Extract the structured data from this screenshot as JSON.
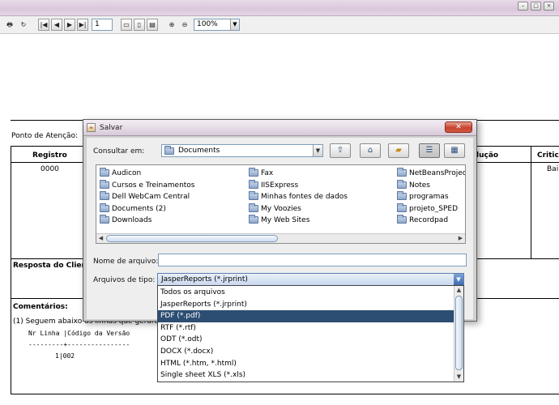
{
  "toolbar": {
    "page_value": "1",
    "zoom_value": "100%"
  },
  "report": {
    "ponto_label": "Ponto de Atenção:",
    "col_registro": "Registro",
    "col_solucao_partial": "lução",
    "col_critic_partial": "Critic",
    "registro_value": "0000",
    "critic_value_partial": "Bai",
    "resposta_label": "Resposta do Clien",
    "comentarios_label": "Comentários:",
    "comment_line": "(1) Seguem abaixo as linhas que geraram",
    "mono_header": "Nr Linha |Código da Versão",
    "mono_separator": "---------+----------------",
    "mono_row": "1|002"
  },
  "dialog": {
    "title": "Salvar",
    "lookin_label": "Consultar em:",
    "lookin_value": "Documents",
    "nav_buttons": [
      "up-folder",
      "home",
      "new-folder",
      "list-view",
      "details-view"
    ],
    "files": [
      [
        "Audicon",
        "Cursos e Treinamentos",
        "Dell WebCam Central",
        "Documents (2)",
        "Downloads"
      ],
      [
        "Fax",
        "IISExpress",
        "Minhas fontes de dados",
        "My Voozies",
        "My Web Sites"
      ],
      [
        "NetBeansProjects",
        "Notes",
        "programas",
        "projeto_SPED",
        "Recordpad"
      ]
    ],
    "filename_label": "Nome de arquivo:",
    "filename_value": "",
    "filetype_label": "Arquivos de tipo:",
    "filetype_value": "JasperReports (*.jrprint)",
    "filetype_options": [
      "Todos os arquivos",
      "JasperReports (*.jrprint)",
      "PDF (*.pdf)",
      "RTF (*.rtf)",
      "ODT (*.odt)",
      "DOCX (*.docx)",
      "HTML (*.htm, *.html)",
      "Single sheet XLS (*.xls)"
    ],
    "selected_option_index": 2
  }
}
